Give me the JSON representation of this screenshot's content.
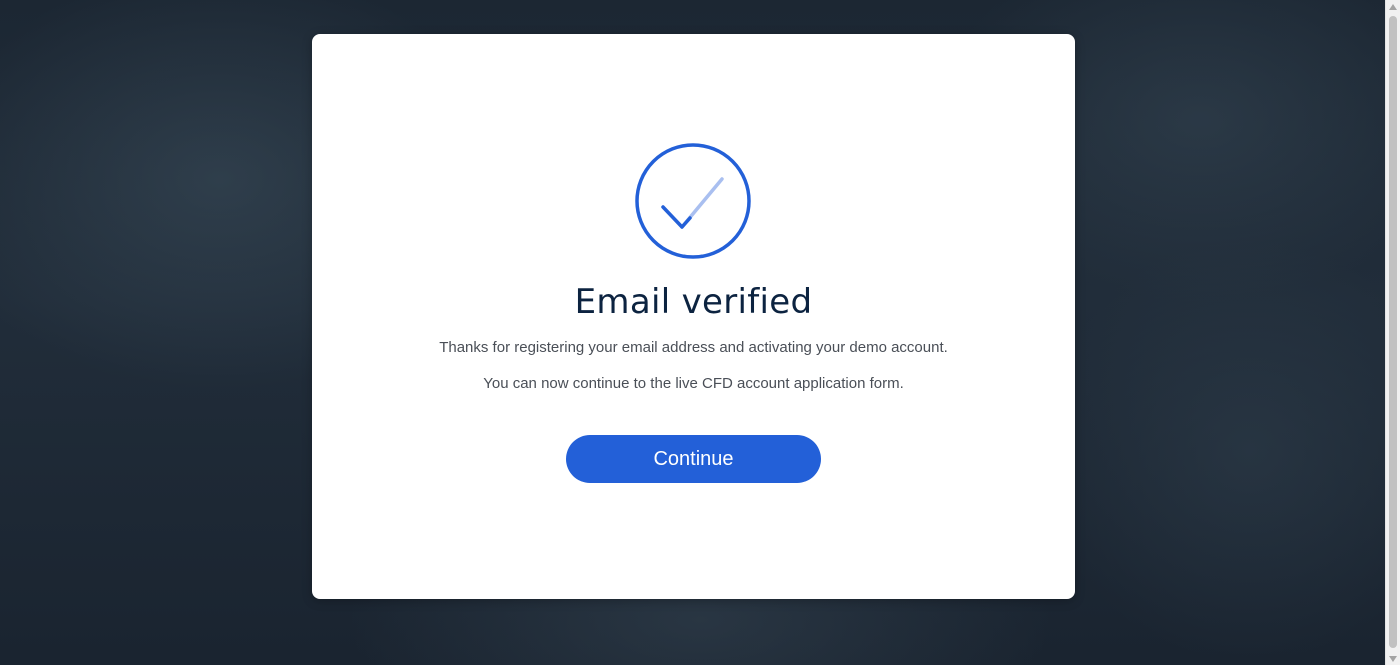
{
  "modal": {
    "title": "Email verified",
    "message_1": "Thanks for registering your email address and activating your demo account.",
    "message_2": "You can now continue to the live CFD account application form.",
    "continue_label": "Continue"
  },
  "icons": {
    "status": "check-circle-icon"
  },
  "colors": {
    "accent": "#2360d8",
    "check_light": "#a9bff0",
    "title": "#0c2340",
    "backdrop": "#1e2a36"
  }
}
